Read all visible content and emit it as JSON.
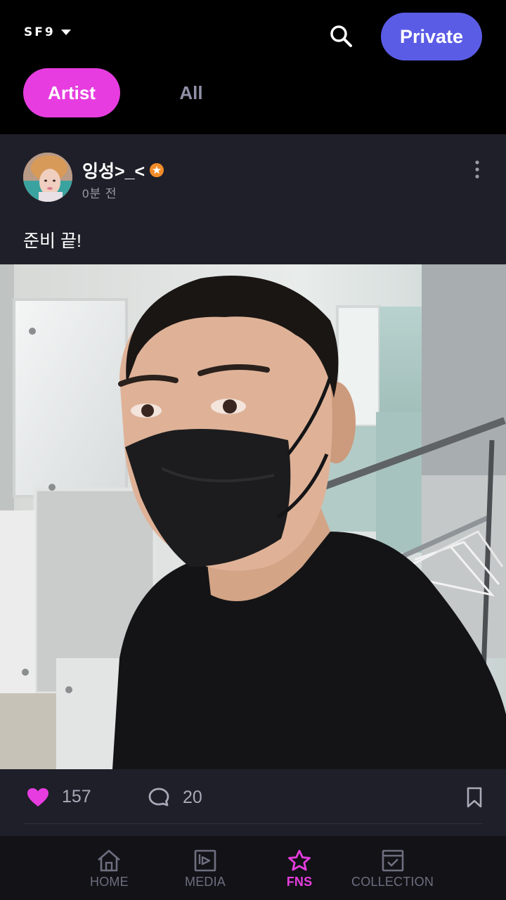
{
  "header": {
    "group_name": "SF9",
    "private_label": "Private"
  },
  "tabs": [
    {
      "label": "Artist",
      "active": true
    },
    {
      "label": "All",
      "active": false
    }
  ],
  "post": {
    "author": "잉성>_<",
    "time": "0분 전",
    "text": "준비 끝!",
    "likes": "157",
    "comments": "20",
    "like_color": "#e73de0"
  },
  "nav": {
    "items": [
      {
        "label": "HOME",
        "icon": "home-icon",
        "active": false
      },
      {
        "label": "MEDIA",
        "icon": "media-icon",
        "active": false
      },
      {
        "label": "FNS",
        "icon": "star-icon",
        "active": true
      },
      {
        "label": "COLLECTION",
        "icon": "collection-icon",
        "active": false
      }
    ]
  },
  "colors": {
    "accent": "#e73de0",
    "private_button": "#5b5ce6",
    "card_bg": "#1f1f29"
  }
}
